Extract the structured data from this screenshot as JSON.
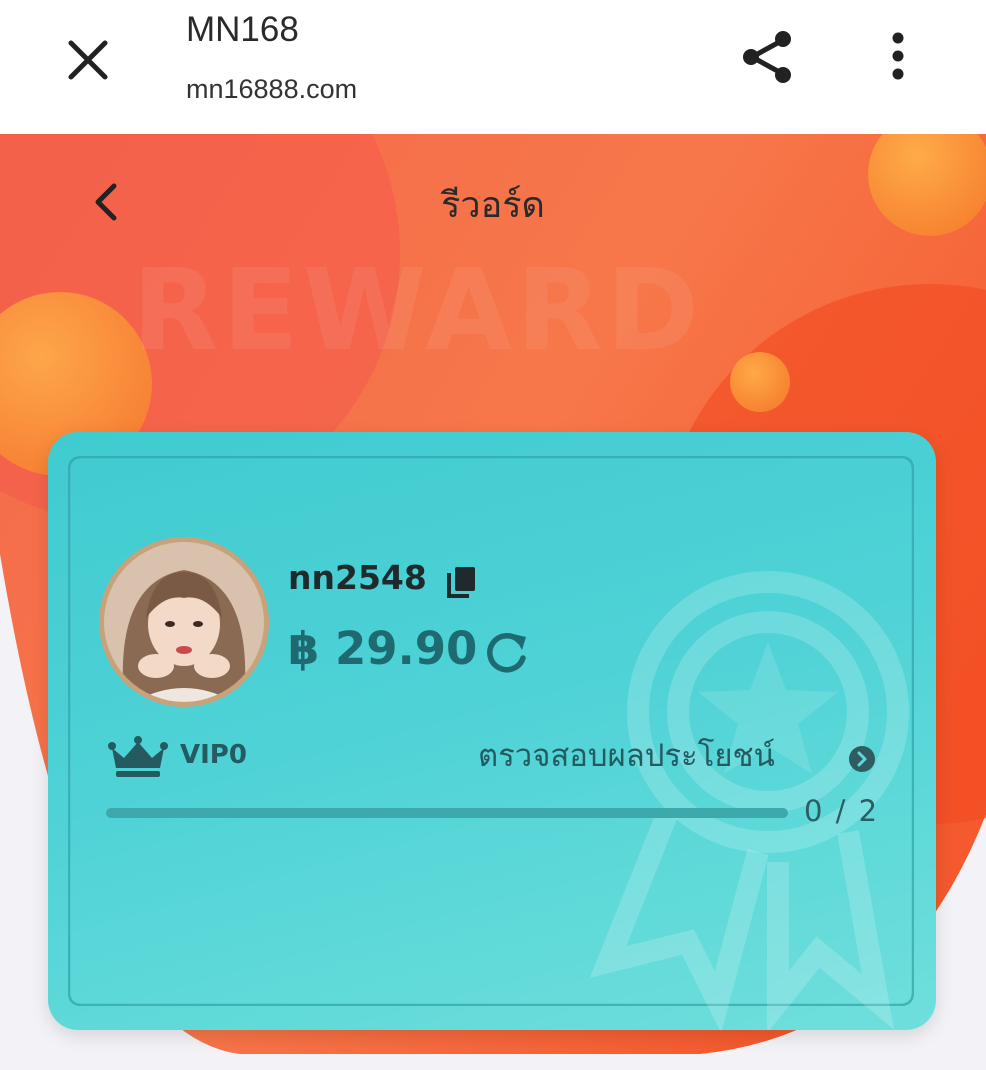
{
  "browser": {
    "site_title": "MN168",
    "site_url": "mn16888.com",
    "icons": {
      "close": "close-icon",
      "share": "share-icon",
      "more": "more-vertical-icon"
    }
  },
  "page": {
    "title": "รีวอร์ด",
    "watermark": "REWARD",
    "back_icon": "chevron-left-icon"
  },
  "card": {
    "username": "nn2548",
    "balance": "฿ 29.90",
    "vip_level": "VIP0",
    "benefits_link": "ตรวจสอบผลประโยชน์",
    "progress": {
      "current": 0,
      "target": 2,
      "text": "0 / 2"
    },
    "icons": {
      "avatar": "user-avatar",
      "copy": "copy-icon",
      "refresh": "refresh-icon",
      "crown": "crown-icon",
      "benefits_arrow": "chevron-right-circle-icon"
    }
  },
  "colors": {
    "hero_orange": "#f5663f",
    "card_teal": "#4ed2d6",
    "progress_fill": "#1f6a71"
  }
}
